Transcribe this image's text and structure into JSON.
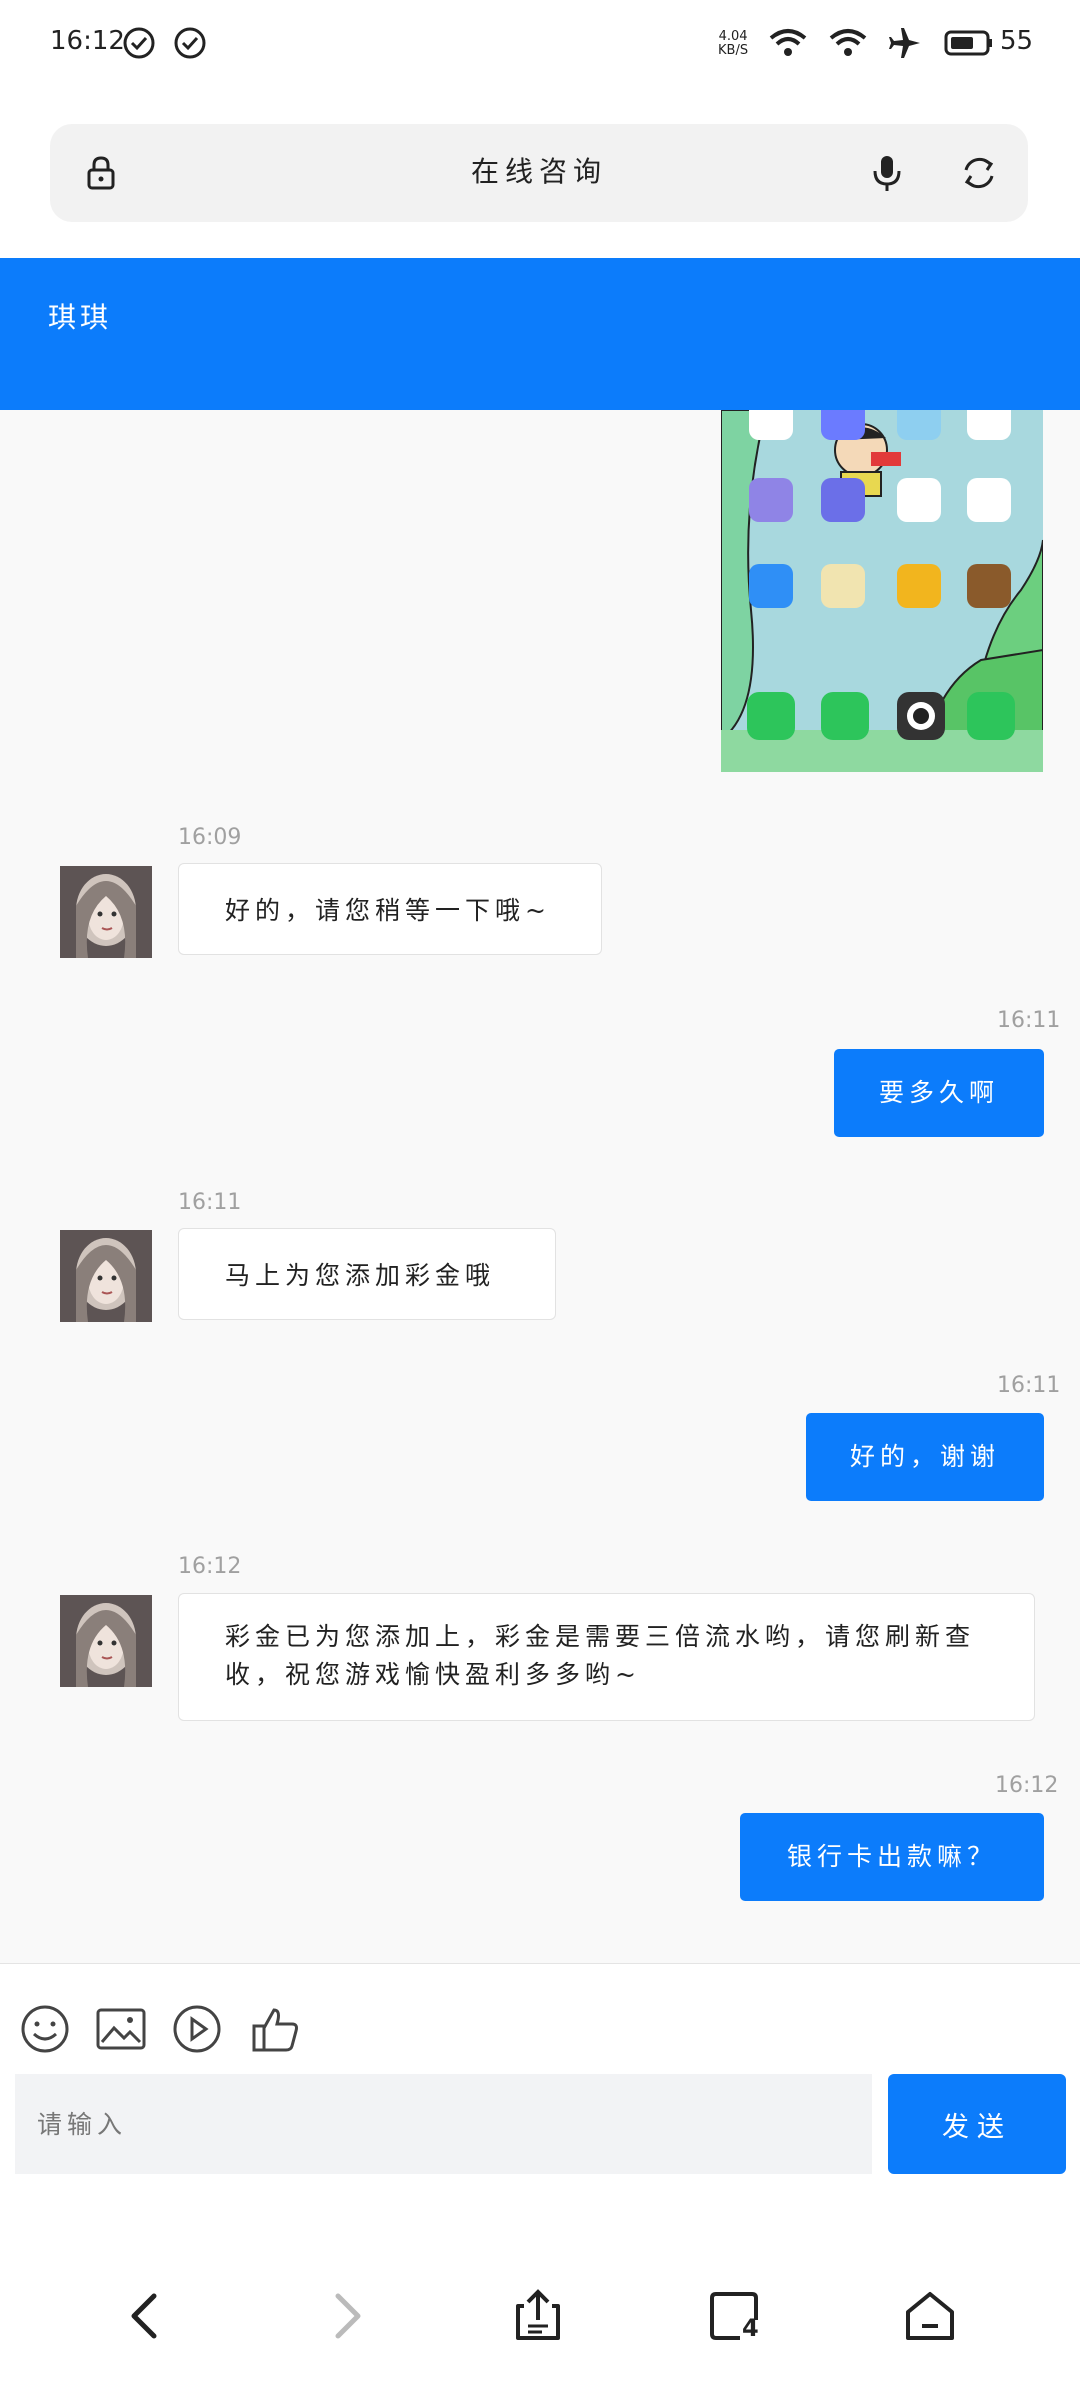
{
  "status_bar": {
    "time": "16:12",
    "net_speed_value": "4.04",
    "net_speed_unit": "KB/S",
    "battery": "55",
    "icons": [
      "check-circle-icon",
      "check-circle-icon",
      "wifi-icon",
      "wifi-icon",
      "airplane-icon",
      "battery-icon"
    ]
  },
  "browser": {
    "page_title": "在线咨询",
    "icons": {
      "left": "lock-icon",
      "mic": "microphone-icon",
      "refresh": "refresh-icon"
    }
  },
  "chat": {
    "agent_name": "琪琪",
    "accent_color": "#0c7cfb",
    "messages": [
      {
        "dir": "out",
        "type": "image",
        "content": "phone home screen screenshot"
      },
      {
        "dir": "in",
        "time": "16:09",
        "text": "好的，请您稍等一下哦~"
      },
      {
        "dir": "out",
        "time": "16:11",
        "text": "要多久啊"
      },
      {
        "dir": "in",
        "time": "16:11",
        "text": "马上为您添加彩金哦"
      },
      {
        "dir": "out",
        "time": "16:11",
        "text": "好的，谢谢"
      },
      {
        "dir": "in",
        "time": "16:12",
        "text": "彩金已为您添加上，彩金是需要三倍流水哟，请您刷新查收，祝您游戏愉快盈利多多哟~"
      },
      {
        "dir": "out",
        "time": "16:12",
        "text": "银行卡出款嘛？"
      }
    ]
  },
  "composer": {
    "tools": [
      "emoji-icon",
      "image-icon",
      "video-icon",
      "thumbs-up-icon"
    ],
    "placeholder": "请输入",
    "send_label": "发送"
  },
  "nav_bar": {
    "tab_count": "4",
    "icons": [
      "back-icon",
      "forward-icon",
      "share-icon",
      "tabs-icon",
      "home-icon"
    ]
  }
}
